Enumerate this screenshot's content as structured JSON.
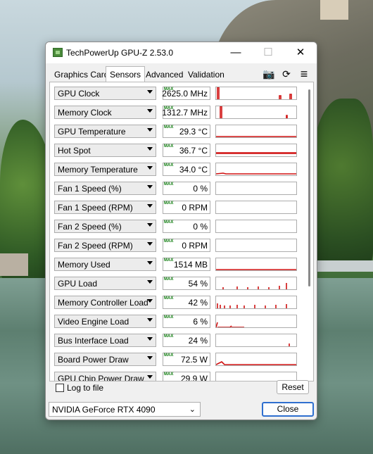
{
  "window": {
    "title": "TechPowerUp GPU-Z 2.53.0",
    "minimize_label": "—",
    "maximize_label": "☐",
    "close_label": "✕"
  },
  "tabs": [
    {
      "label": "Graphics Card"
    },
    {
      "label": "Sensors"
    },
    {
      "label": "Advanced"
    },
    {
      "label": "Validation"
    }
  ],
  "toolbar": {
    "camera_glyph": "📷",
    "refresh_glyph": "⟳",
    "menu_glyph": "≡"
  },
  "max_badge": "MAX",
  "sensors": [
    {
      "label": "GPU Clock",
      "value": "2625.0 MHz"
    },
    {
      "label": "Memory Clock",
      "value": "1312.7 MHz"
    },
    {
      "label": "GPU Temperature",
      "value": "29.3 °C"
    },
    {
      "label": "Hot Spot",
      "value": "36.7 °C"
    },
    {
      "label": "Memory Temperature",
      "value": "34.0 °C"
    },
    {
      "label": "Fan 1 Speed (%)",
      "value": "0 %"
    },
    {
      "label": "Fan 1 Speed (RPM)",
      "value": "0 RPM"
    },
    {
      "label": "Fan 2 Speed (%)",
      "value": "0 %"
    },
    {
      "label": "Fan 2 Speed (RPM)",
      "value": "0 RPM"
    },
    {
      "label": "Memory Used",
      "value": "1514 MB"
    },
    {
      "label": "GPU Load",
      "value": "54 %"
    },
    {
      "label": "Memory Controller Load",
      "value": "42 %"
    },
    {
      "label": "Video Engine Load",
      "value": "6 %"
    },
    {
      "label": "Bus Interface Load",
      "value": "24 %"
    },
    {
      "label": "Board Power Draw",
      "value": "72.5 W"
    },
    {
      "label": "GPU Chip Power Draw",
      "value": "29.9 W"
    }
  ],
  "footer": {
    "log_label": "Log to file",
    "log_checked": false,
    "reset_label": "Reset",
    "gpu_selected": "NVIDIA GeForce RTX 4090",
    "close_label": "Close"
  },
  "colors": {
    "graph_line": "#d01010",
    "max_badge": "#0a7a0a",
    "close_border": "#2f6fcf"
  }
}
